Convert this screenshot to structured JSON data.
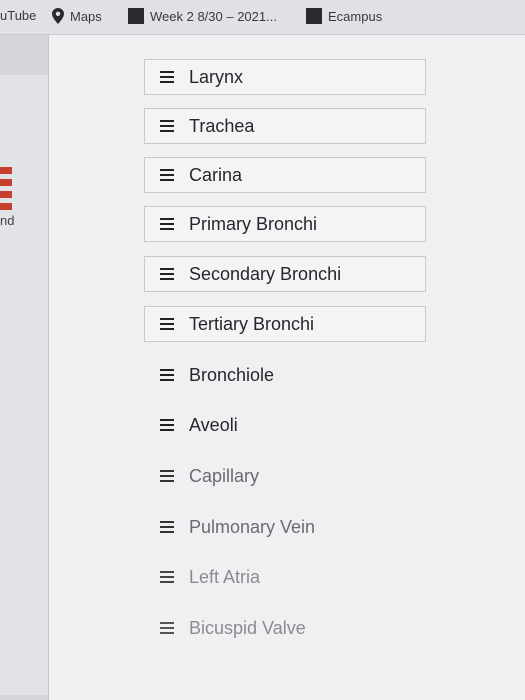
{
  "bookmarks": {
    "youtube": "uTube",
    "maps": "Maps",
    "week": "Week 2 8/30 – 2021...",
    "ecampus": "Ecampus"
  },
  "left_sliver": {
    "text": "nd"
  },
  "sortable_list": {
    "items": [
      {
        "label": "Larynx"
      },
      {
        "label": "Trachea"
      },
      {
        "label": "Carina"
      },
      {
        "label": "Primary Bronchi"
      },
      {
        "label": "Secondary Bronchi"
      },
      {
        "label": "Tertiary Bronchi"
      },
      {
        "label": "Bronchiole"
      },
      {
        "label": "Aveoli"
      },
      {
        "label": "Capillary"
      },
      {
        "label": "Pulmonary Vein"
      },
      {
        "label": "Left Atria"
      },
      {
        "label": "Bicuspid Valve"
      }
    ]
  },
  "colors": {
    "accent": "#c5412d",
    "item_border": "#c7c9cc"
  }
}
